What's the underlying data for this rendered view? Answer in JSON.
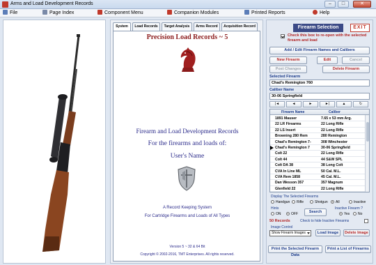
{
  "window": {
    "title": "Arms and Load Development Records",
    "minimize": "–",
    "maximize": "□",
    "close": "✕"
  },
  "menu": {
    "file": "File",
    "page_index": "Page Index",
    "component_menu": "Component Menu",
    "companion_modules": "Companion Modules",
    "printed_reports": "Printed Reports",
    "help": "Help"
  },
  "tabs": [
    "System",
    "Load Records",
    "Target Analysis",
    "Arms Record",
    "Acquisition Record"
  ],
  "center": {
    "header": "Precision Load Records ~ 5",
    "line1": "Firearm and Load Development Records",
    "line2": "For the firearms and loads of:",
    "line3": "User's Name",
    "record_keeping": "A Record Keeping System",
    "cartridge": "For Cartridge Firearms and Loads of All Types",
    "version": "Version 5 ~ 32 & 64 Bit",
    "copyright": "Copyright © 2002-2016, TMT Enterprises. All rights reserved."
  },
  "right": {
    "title": "Firearm Selection",
    "exit": "EXIT",
    "reopen_text": "Check this box to re-open with the selected firearm and load",
    "add_edit": "Add / Edit Firearm Names and Calibers",
    "new_firearm": "New Firearm",
    "edit": "Edit",
    "cancel": "Cancel",
    "post_changes": "Post Changes",
    "delete_firearm": "Delete Firearm",
    "selected_firearm_label": "Selected Firearm",
    "selected_firearm": "Chad's Remington 760",
    "caliber_label": "Caliber Name",
    "caliber": "30-06 Springfield",
    "nav": [
      "|◄",
      "◄",
      "►",
      "►|",
      "▲",
      "↻"
    ],
    "col_firearm": "Firearm Name",
    "col_caliber": "Caliber",
    "rows": [
      {
        "name": "1891 Mauser",
        "caliber": "7.65 x 53 mm Arg."
      },
      {
        "name": "22 LR Firearms",
        "caliber": "22 Long Rifle"
      },
      {
        "name": "22 LS Insert",
        "caliber": "22 Long Rifle"
      },
      {
        "name": "Browning 280 Rem",
        "caliber": "280 Remington"
      },
      {
        "name": "Chad's Remington 7-",
        "caliber": "308 Winchester"
      },
      {
        "name": "Chad's Remington 7",
        "caliber": "30-06 Springfield"
      },
      {
        "name": "Colt 22",
        "caliber": "22 Long Rifle"
      },
      {
        "name": "Colt 44",
        "caliber": "44 S&W SPL"
      },
      {
        "name": "Colt DA 38",
        "caliber": "38 Long Colt"
      },
      {
        "name": "CVA In Line ML",
        "caliber": "50 Cal. M.L."
      },
      {
        "name": "CVA Rem 1858",
        "caliber": "45 Cal. M.L."
      },
      {
        "name": "Dan Wesson 357",
        "caliber": "357 Magnum"
      },
      {
        "name": "Glenfield 22",
        "caliber": "22 Long Rifle"
      }
    ],
    "display_label": "Display The Selected Firearms",
    "filters": [
      "Handgun",
      "Rifle",
      "Shotgun",
      "All"
    ],
    "inactive": "Inactive",
    "hints_label": "Hints",
    "on": "ON",
    "off": "OFF",
    "search": "Search",
    "inactive_q": "Inactive Firearm ?",
    "yes": "Yes",
    "no": "No",
    "records": "50 Records",
    "hide_inactive": "Check to hide Inactive Firearms",
    "image_control": "Image Control",
    "show_images": "Show Firearm Images",
    "load_image": "Load Image",
    "delete_image": "Delete Image",
    "print_selected": "Print the Selected Firearm Data",
    "print_list": "Print a List of Firearms"
  },
  "colors": {
    "accent_navy": "#3b4a86",
    "accent_red": "#b22222",
    "header_text": "#8b1a1a",
    "link_blue": "#1a3a8a"
  }
}
